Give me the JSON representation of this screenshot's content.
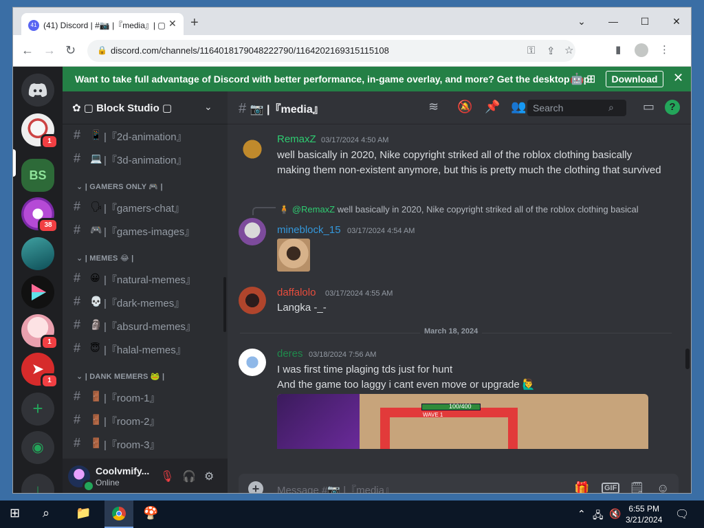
{
  "browser": {
    "tab_title": "(41) Discord | #📷 |『media』| ▢ ...",
    "tab_badge": "41",
    "url": "discord.com/channels/1164018179048222790/1164202169315115108"
  },
  "banner": {
    "message": "Want to take full advantage of Discord with better performance, in-game overlay, and more? Get the desktop app!",
    "download_label": "Download"
  },
  "server": {
    "name": "▢ Block Studio ▢"
  },
  "guild_badges": [
    "1",
    "38",
    "1",
    "1"
  ],
  "channels": [
    {
      "type": "channel",
      "emoji": "📱",
      "label": "|『2d-animation』"
    },
    {
      "type": "channel",
      "emoji": "💻",
      "label": "|『3d-animation』"
    },
    {
      "type": "category",
      "label": "| GAMERS ONLY 🎮 |"
    },
    {
      "type": "channel",
      "emoji": "🗣",
      "label": "|『gamers-chat』"
    },
    {
      "type": "channel",
      "emoji": "🎮",
      "label": "|『games-images』"
    },
    {
      "type": "category",
      "label": "| MEMES 😂 |"
    },
    {
      "type": "channel",
      "emoji": "😀",
      "label": "|『natural-memes』"
    },
    {
      "type": "channel",
      "emoji": "💀",
      "label": "|『dark-memes』"
    },
    {
      "type": "channel",
      "emoji": "🗿",
      "label": "|『absurd-memes』"
    },
    {
      "type": "channel",
      "emoji": "😇",
      "label": "|『halal-memes』"
    },
    {
      "type": "category",
      "label": "| DANK MEMERS 🐸 |"
    },
    {
      "type": "channel",
      "emoji": "🚪",
      "label": "|『room-1』"
    },
    {
      "type": "channel",
      "emoji": "🚪",
      "label": "|『room-2』"
    },
    {
      "type": "channel",
      "emoji": "🚪",
      "label": "|『room-3』"
    }
  ],
  "user": {
    "name": "Coolvmify...",
    "status": "Online"
  },
  "chat": {
    "channel_name": "📷 |『media』",
    "search_placeholder": "Search",
    "composer_placeholder": "Message #📷 |『media』",
    "date_divider": "March 18, 2024"
  },
  "messages": [
    {
      "author": "RemaxZ",
      "author_color": "#2ecc71",
      "timestamp": "03/17/2024 4:50 AM",
      "text": "well basically in 2020, Nike copyright striked all of the roblox clothing basically making them non-existent anymore, but this is pretty much the clothing that survived"
    },
    {
      "author": "mineblock_15",
      "author_color": "#3498db",
      "timestamp": "03/17/2024 4:54 AM",
      "reply_author": "@RemaxZ",
      "reply_text": "well basically in 2020, Nike copyright striked all of the roblox clothing basical"
    },
    {
      "author": "daffalolo",
      "author_color": "#e74c3c",
      "timestamp": "03/17/2024 4:55 AM",
      "text": "Langka -_-"
    },
    {
      "author": "deres",
      "author_color": "#1f8b4c",
      "timestamp": "03/18/2024 7:56 AM",
      "line1": "I was first time plaging tds just for hunt",
      "line2": "And the game too laggy i cant even move or upgrade 🙋‍♂️"
    }
  ],
  "game_screenshot": {
    "hud_value": "100/400",
    "hud_label": "WAVE 1"
  },
  "taskbar": {
    "time": "6:55 PM",
    "date": "3/21/2024"
  },
  "colors": {
    "blurple": "#5865f2",
    "green": "#23a55a",
    "banner": "#248046",
    "red": "#f23f43"
  }
}
